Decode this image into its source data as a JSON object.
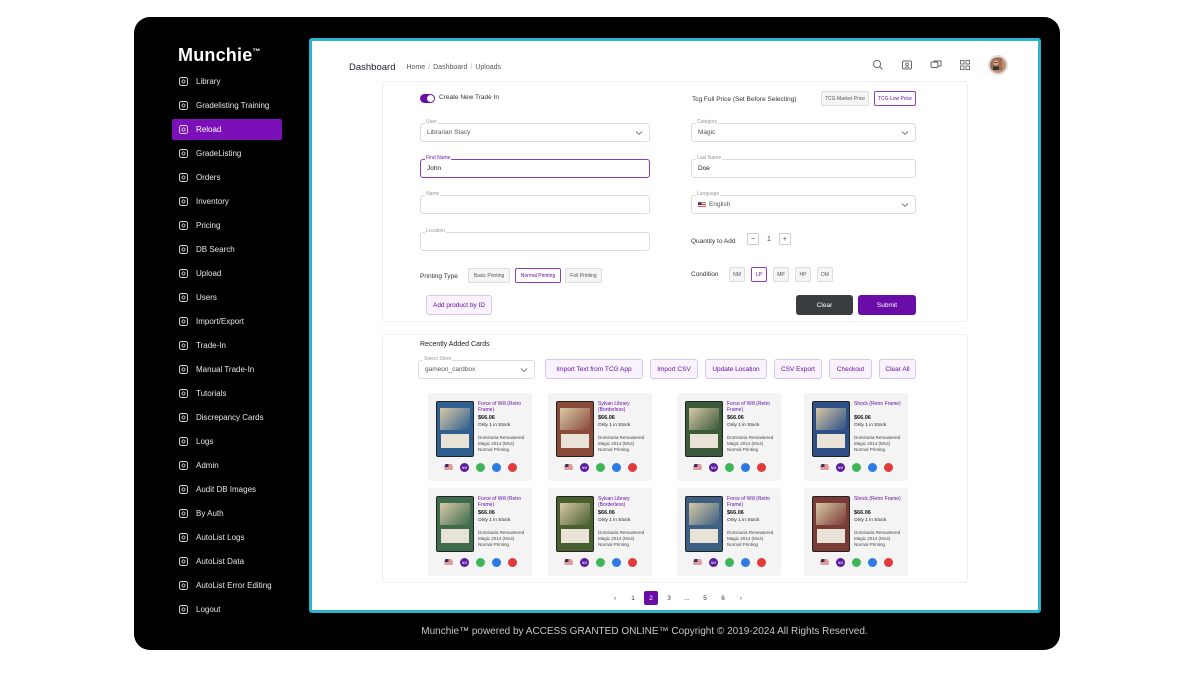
{
  "app": {
    "logo": "Munchie",
    "logo_tm": "™",
    "footer": "Munchie™ powered by ACCESS GRANTED ONLINE™ Copyright © 2019-2024 All Rights Reserved."
  },
  "sidebar": {
    "items": [
      {
        "label": "Library",
        "icon": "library-icon"
      },
      {
        "label": "Gradelisting Training",
        "icon": "training-icon"
      },
      {
        "label": "Reload",
        "icon": "reload-icon",
        "active": true
      },
      {
        "label": "GradeListing",
        "icon": "gradelisting-icon"
      },
      {
        "label": "Orders",
        "icon": "orders-icon"
      },
      {
        "label": "Inventory",
        "icon": "inventory-icon"
      },
      {
        "label": "Pricing",
        "icon": "pricing-icon"
      },
      {
        "label": "DB Search",
        "icon": "db-search-icon"
      },
      {
        "label": "Upload",
        "icon": "upload-icon"
      },
      {
        "label": "Users",
        "icon": "users-icon"
      },
      {
        "label": "Import/Export",
        "icon": "import-export-icon"
      },
      {
        "label": "Trade-In",
        "icon": "trade-in-icon"
      },
      {
        "label": "Manual Trade-In",
        "icon": "manual-trade-in-icon"
      },
      {
        "label": "Tutorials",
        "icon": "tutorials-icon"
      },
      {
        "label": "Discrepancy Cards",
        "icon": "discrepancy-icon"
      },
      {
        "label": "Logs",
        "icon": "logs-icon"
      },
      {
        "label": "Admin",
        "icon": "admin-icon"
      },
      {
        "label": "Audit DB Images",
        "icon": "audit-icon"
      },
      {
        "label": "By Auth",
        "icon": "auth-icon"
      },
      {
        "label": "AutoList Logs",
        "icon": "autolist-logs-icon"
      },
      {
        "label": "AutoList Data",
        "icon": "autolist-data-icon"
      },
      {
        "label": "AutoList Error Editing",
        "icon": "autolist-error-icon"
      },
      {
        "label": "Logout",
        "icon": "logout-icon"
      }
    ]
  },
  "header": {
    "title": "Dashboard",
    "breadcrumb": [
      "Home",
      "Dashboard",
      "Uploads"
    ]
  },
  "form": {
    "toggle_label": "Create New Trade In",
    "tcg_label": "Tcg Full Price (Set Before Selecting)",
    "tcg_market": "TCG Market Price",
    "tcg_low": "TCG Low Price",
    "user_label": "User",
    "user_value": "Librarian Stacy",
    "category_label": "Category",
    "category_value": "Magic",
    "first_name_label": "First Name",
    "first_name_value": "John",
    "last_name_label": "Last Name",
    "last_name_value": "Doe",
    "name_label": "Name",
    "language_label": "Language",
    "language_value": "English",
    "location_label": "Location",
    "quantity_label": "Quantity to Add",
    "quantity_minus": "−",
    "quantity_value": "1",
    "quantity_plus": "+",
    "printing_label": "Printing Type",
    "printing_options": [
      "Basic Printing",
      "Normal Printing",
      "Foil Printing"
    ],
    "printing_selected": "Normal Printing",
    "condition_label": "Condition",
    "condition_options": [
      "NM",
      "LP",
      "MP",
      "HP",
      "DM"
    ],
    "condition_selected": "LP",
    "add_by_id": "Add product by ID",
    "clear": "Clear",
    "submit": "Submit"
  },
  "recent": {
    "title": "Recently Added Cards",
    "store_label": "Select Store",
    "store_value": "gameon_cardbox",
    "actions": [
      "Import Text from TCG App",
      "Import CSV",
      "Update Location",
      "CSV Export",
      "Checkout",
      "Clear All"
    ],
    "cards": [
      {
        "title": "Force of Will (Retro Frame)",
        "price": "$66.06",
        "stock": "Only 1 in Stock",
        "set": "Dominaria Remastered",
        "set2": "Magic 2014 (M14)",
        "printing": "Normal Printing",
        "color": "#2f5f8f",
        "badge": "NM"
      },
      {
        "title": "Sylvan Library (Borderless)",
        "price": "$66.06",
        "stock": "Only 1 in Stock",
        "set": "Dominaria Remastered",
        "set2": "Magic 2014 (M14)",
        "printing": "Normal Printing",
        "color": "#8a4a3a",
        "badge": "NM"
      },
      {
        "title": "Force of Will (Retro Frame)",
        "price": "$66.06",
        "stock": "Only 1 in Stock",
        "set": "Dominaria Remastered",
        "set2": "Magic 2014 (M14)",
        "printing": "Normal Printing",
        "color": "#3a5a3a",
        "badge": "NM"
      },
      {
        "title": "Shock (Retro Frame)",
        "price": "$66.06",
        "stock": "Only 1 in Stock",
        "set": "Dominaria Remastered",
        "set2": "Magic 2014 (M14)",
        "printing": "Normal Printing",
        "color": "#2d4f86",
        "badge": "NM"
      },
      {
        "title": "Force of Will (Retro Frame)",
        "price": "$66.06",
        "stock": "Only 1 in Stock",
        "set": "Dominaria Remastered",
        "set2": "Magic 2014 (M14)",
        "printing": "Normal Printing",
        "color": "#3f6b4d",
        "badge": "NM"
      },
      {
        "title": "Sylvan Library (Borderless)",
        "price": "$66.06",
        "stock": "Only 1 in Stock",
        "set": "Dominaria Remastered",
        "set2": "Magic 2014 (M14)",
        "printing": "Normal Printing",
        "color": "#4a5f2f",
        "badge": "NM"
      },
      {
        "title": "Force of Will (Retro Frame)",
        "price": "$66.06",
        "stock": "Only 1 in Stock",
        "set": "Dominaria Remastered",
        "set2": "Magic 2014 (M14)",
        "printing": "Normal Printing",
        "color": "#3c5f82",
        "badge": "NM"
      },
      {
        "title": "Shock (Retro Frame)",
        "price": "$66.06",
        "stock": "Only 1 in Stock",
        "set": "Dominaria Remastered",
        "set2": "Magic 2014 (M14)",
        "printing": "Normal Printing",
        "color": "#7a3a36",
        "badge": "NM"
      }
    ]
  },
  "pagination": {
    "prev": "‹",
    "pages": [
      "1",
      "2",
      "3",
      "...",
      "5",
      "6"
    ],
    "current": "2",
    "next": "›"
  },
  "colors": {
    "accent": "#6a0da8",
    "frame_border": "#2bb4cf"
  }
}
